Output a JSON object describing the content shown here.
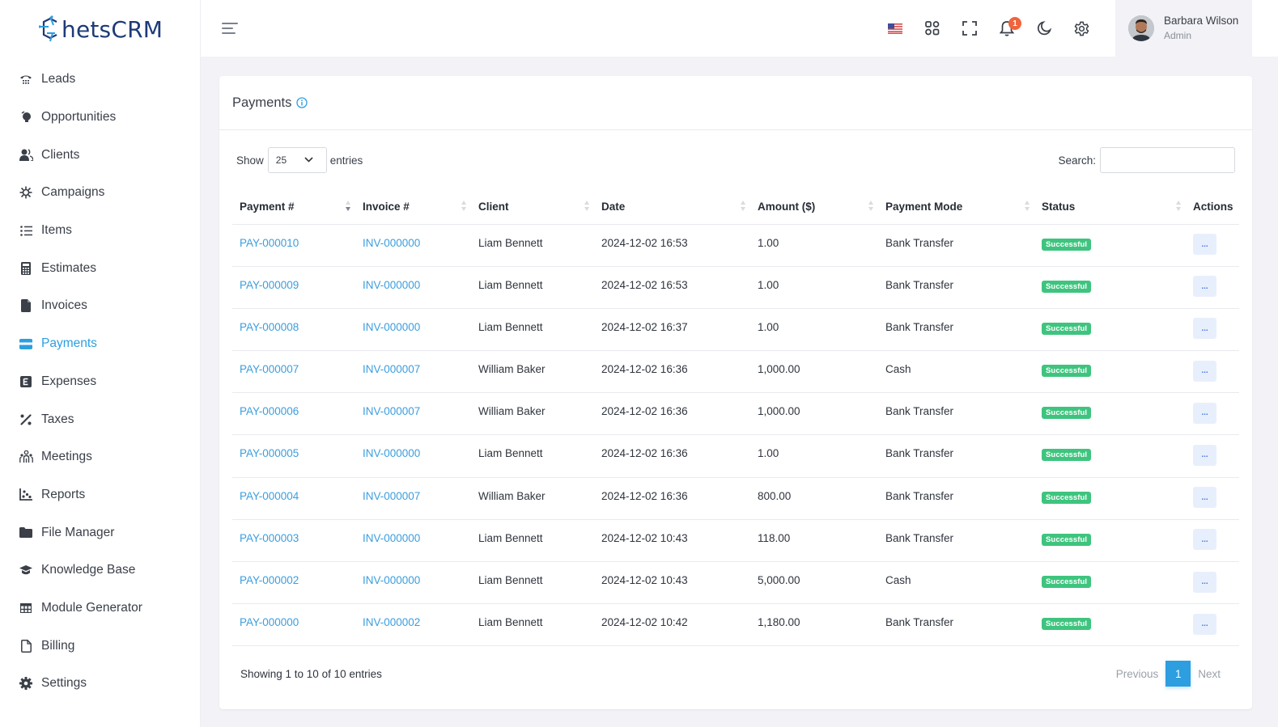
{
  "brand": {
    "name": "hetsCRM",
    "logo_icon": "hexagon-c-logo"
  },
  "sidebar": {
    "items": [
      {
        "label": "Leads",
        "icon": "phone-icon",
        "active": false
      },
      {
        "label": "Opportunities",
        "icon": "lightbulb-icon",
        "active": false
      },
      {
        "label": "Clients",
        "icon": "users-icon",
        "active": false
      },
      {
        "label": "Campaigns",
        "icon": "virus-icon",
        "active": false
      },
      {
        "label": "Items",
        "icon": "list-icon",
        "active": false
      },
      {
        "label": "Estimates",
        "icon": "calculator-icon",
        "active": false
      },
      {
        "label": "Invoices",
        "icon": "file-icon",
        "active": false
      },
      {
        "label": "Payments",
        "icon": "credit-card-icon",
        "active": true
      },
      {
        "label": "Expenses",
        "icon": "expense-e-icon",
        "active": false
      },
      {
        "label": "Taxes",
        "icon": "percent-icon",
        "active": false
      },
      {
        "label": "Meetings",
        "icon": "people-group-icon",
        "active": false
      },
      {
        "label": "Reports",
        "icon": "chart-scatter-icon",
        "active": false
      },
      {
        "label": "File Manager",
        "icon": "folder-icon",
        "active": false
      },
      {
        "label": "Knowledge Base",
        "icon": "graduation-cap-icon",
        "active": false
      },
      {
        "label": "Module Generator",
        "icon": "table-grid-icon",
        "active": false
      },
      {
        "label": "Billing",
        "icon": "file-outline-icon",
        "active": false
      },
      {
        "label": "Settings",
        "icon": "gear-icon",
        "active": false
      }
    ]
  },
  "topbar": {
    "notification_count": "1",
    "user": {
      "name": "Barbara Wilson",
      "role": "Admin"
    }
  },
  "page": {
    "title": "Payments",
    "show_label": "Show",
    "entries_label": "entries",
    "page_size": "25",
    "search_label": "Search:",
    "search_value": "",
    "columns": [
      "Payment #",
      "Invoice #",
      "Client",
      "Date",
      "Amount ($)",
      "Payment Mode",
      "Status",
      "Actions"
    ],
    "rows": [
      {
        "payment": "PAY-000010",
        "invoice": "INV-000000",
        "client": "Liam Bennett",
        "date": "2024-12-02 16:53",
        "amount": "1.00",
        "mode": "Bank Transfer",
        "status": "Successful",
        "action": "..."
      },
      {
        "payment": "PAY-000009",
        "invoice": "INV-000000",
        "client": "Liam Bennett",
        "date": "2024-12-02 16:53",
        "amount": "1.00",
        "mode": "Bank Transfer",
        "status": "Successful",
        "action": "..."
      },
      {
        "payment": "PAY-000008",
        "invoice": "INV-000000",
        "client": "Liam Bennett",
        "date": "2024-12-02 16:37",
        "amount": "1.00",
        "mode": "Bank Transfer",
        "status": "Successful",
        "action": "..."
      },
      {
        "payment": "PAY-000007",
        "invoice": "INV-000007",
        "client": "William Baker",
        "date": "2024-12-02 16:36",
        "amount": "1,000.00",
        "mode": "Cash",
        "status": "Successful",
        "action": "..."
      },
      {
        "payment": "PAY-000006",
        "invoice": "INV-000007",
        "client": "William Baker",
        "date": "2024-12-02 16:36",
        "amount": "1,000.00",
        "mode": "Bank Transfer",
        "status": "Successful",
        "action": "..."
      },
      {
        "payment": "PAY-000005",
        "invoice": "INV-000000",
        "client": "Liam Bennett",
        "date": "2024-12-02 16:36",
        "amount": "1.00",
        "mode": "Bank Transfer",
        "status": "Successful",
        "action": "..."
      },
      {
        "payment": "PAY-000004",
        "invoice": "INV-000007",
        "client": "William Baker",
        "date": "2024-12-02 16:36",
        "amount": "800.00",
        "mode": "Bank Transfer",
        "status": "Successful",
        "action": "..."
      },
      {
        "payment": "PAY-000003",
        "invoice": "INV-000000",
        "client": "Liam Bennett",
        "date": "2024-12-02 10:43",
        "amount": "118.00",
        "mode": "Bank Transfer",
        "status": "Successful",
        "action": "..."
      },
      {
        "payment": "PAY-000002",
        "invoice": "INV-000000",
        "client": "Liam Bennett",
        "date": "2024-12-02 10:43",
        "amount": "5,000.00",
        "mode": "Cash",
        "status": "Successful",
        "action": "..."
      },
      {
        "payment": "PAY-000000",
        "invoice": "INV-000002",
        "client": "Liam Bennett",
        "date": "2024-12-02 10:42",
        "amount": "1,180.00",
        "mode": "Bank Transfer",
        "status": "Successful",
        "action": "..."
      }
    ],
    "footer_info": "Showing 1 to 10 of 10 entries",
    "pagination": {
      "previous": "Previous",
      "current": "1",
      "next": "Next"
    }
  },
  "colors": {
    "accent": "#2d9ee0",
    "link": "#3b9ede",
    "success": "#3ec47e",
    "notification": "#f0643c",
    "brand_dark": "#1e3a78"
  }
}
